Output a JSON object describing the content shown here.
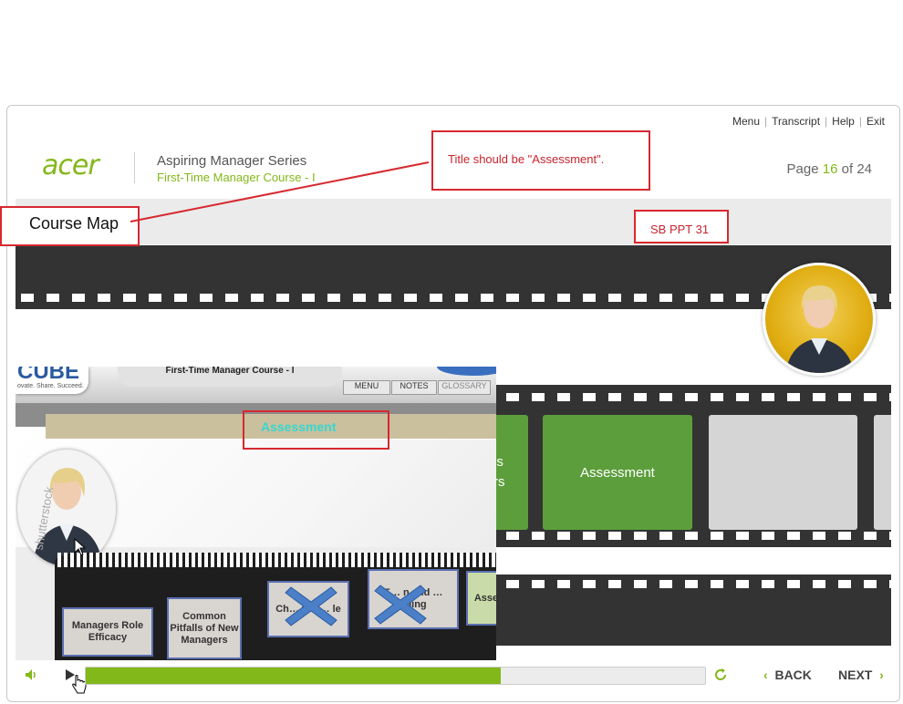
{
  "top_nav": {
    "menu": "Menu",
    "transcript": "Transcript",
    "help": "Help",
    "exit": "Exit"
  },
  "header": {
    "logo": "acer",
    "series": "Aspiring Manager Series",
    "course": "First-Time Manager Course - I",
    "page_label": "Page",
    "page_current": "16",
    "page_of": "of",
    "page_total": "24"
  },
  "slide": {
    "title": "Course Map",
    "cards": [
      {
        "label": "ls\nrs",
        "color": "#5c9e3c"
      },
      {
        "label": "Assessment",
        "color": "#5c9e3c"
      },
      {
        "label": "",
        "color": "#d5d5d5"
      },
      {
        "label": "",
        "color": "#d5d5d5"
      }
    ]
  },
  "callouts": {
    "title_note": "Title should be \"Assessment\".",
    "sb_ref": "SB PPT 31"
  },
  "reference_slide": {
    "brand": "CUBE",
    "tagline": "ovate. Share. Succeed.",
    "course": "First-Time Manager Course - I",
    "menu": "MENU",
    "notes": "NOTES",
    "glossary": "GLOSSARY",
    "title": "Assessment",
    "watermark": "shutterstock",
    "strip": [
      "Managers Role Efficacy",
      "Common Pitfalls of New Managers",
      "Ch… the … le",
      "E… n and … ilding",
      "Asse"
    ]
  },
  "player": {
    "progress": 0.67,
    "back": "BACK",
    "next": "NEXT"
  },
  "colors": {
    "accent": "#83b81a",
    "callout": "#d7282f",
    "film": "#333333",
    "green_card": "#5c9e3c"
  }
}
